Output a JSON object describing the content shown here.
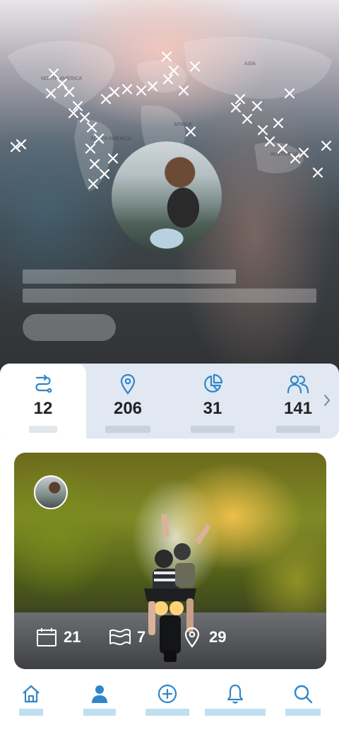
{
  "colors": {
    "accent": "#2f86c8",
    "stats_bg": "#e1e8f2",
    "nav_label_placeholder": "#bfe0f0"
  },
  "map_labels": {
    "asia": "ASIA",
    "africa": "AFRICA",
    "south_america": "SOUTH AMERICA",
    "australia": "AUSTRALIA",
    "north_america": "NORTH AMERICA"
  },
  "stats": {
    "items": [
      {
        "icon": "route-icon",
        "value": "12"
      },
      {
        "icon": "map-pin-icon",
        "value": "206"
      },
      {
        "icon": "pie-chart-icon",
        "value": "31"
      },
      {
        "icon": "users-icon",
        "value": "141"
      }
    ],
    "active_index": 0,
    "next_icon": "chevron-right-icon"
  },
  "post": {
    "counts": [
      {
        "icon": "calendar-icon",
        "value": "21"
      },
      {
        "icon": "flag-icon",
        "value": "7"
      },
      {
        "icon": "map-pin-icon",
        "value": "29"
      }
    ]
  },
  "nav": {
    "items": [
      {
        "icon": "home-icon"
      },
      {
        "icon": "profile-icon",
        "active": true
      },
      {
        "icon": "add-icon"
      },
      {
        "icon": "bell-icon"
      },
      {
        "icon": "search-icon"
      }
    ]
  }
}
